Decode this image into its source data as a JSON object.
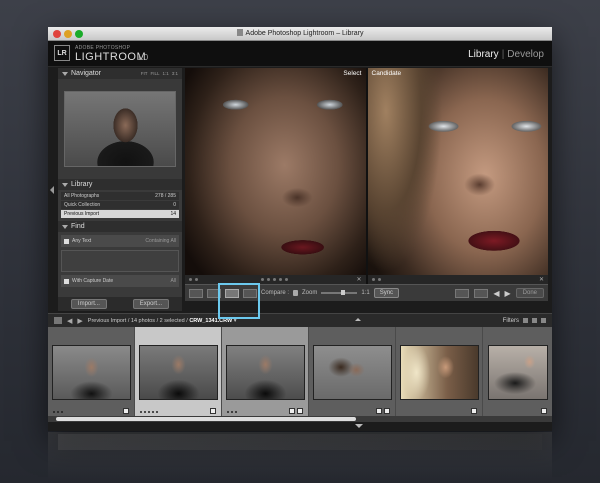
{
  "window": {
    "title": "Adobe Photoshop Lightroom – Library"
  },
  "brand": {
    "badge": "LR",
    "small": "ADOBE PHOTOSHOP",
    "name": "LIGHTROOM",
    "version": "1.0"
  },
  "modules": {
    "library": "Library",
    "separator": "|",
    "develop": "Develop"
  },
  "navigator": {
    "title": "Navigator",
    "zoom": [
      "FIT",
      "FILL",
      "1:1",
      "3:1"
    ]
  },
  "library": {
    "title": "Library",
    "rows": [
      {
        "label": "All Photographs",
        "count": "278 / 285"
      },
      {
        "label": "Quick Collection",
        "count": "0"
      },
      {
        "label": "Previous Import",
        "count": "14"
      }
    ]
  },
  "find": {
    "title": "Find",
    "text_field": "Any Text",
    "text_rule": "Containing All",
    "date_field": "With Capture Date",
    "date_rule": "All"
  },
  "left_buttons": {
    "import": "Import...",
    "export": "Export..."
  },
  "compare": {
    "select_label": "Select",
    "candidate_label": "Candidate"
  },
  "toolbar": {
    "compare_label": "Compare :",
    "zoom_label": "Zoom",
    "zoom_value": "1:1",
    "sync": "Sync",
    "done": "Done"
  },
  "filmbar": {
    "source": "Previous Import",
    "photos": "14 photos",
    "selected": "2 selected",
    "file": "CRW_1341.CRW",
    "filters": "Filters"
  },
  "colors": {
    "highlight": "#6cc9ee",
    "panel": "#3a3a3a",
    "background": "#1c1c1c"
  },
  "icons": [
    "left-arrow-icon",
    "right-arrow-icon",
    "grid-view-icon",
    "loupe-view-icon",
    "compare-view-icon",
    "survey-view-icon",
    "lock-icon",
    "flag-icon"
  ]
}
